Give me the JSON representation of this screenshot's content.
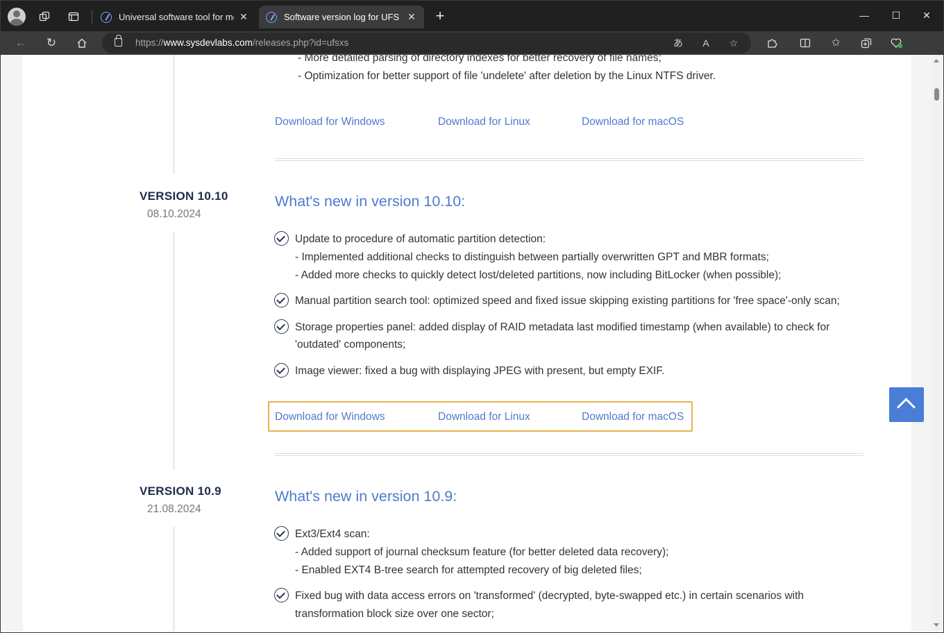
{
  "browser": {
    "tabs": [
      {
        "title": "Universal software tool for most c",
        "active": false
      },
      {
        "title": "Software version log for UFS Explo",
        "active": true
      }
    ],
    "url_prefix": "https://",
    "url_host": "www.sysdevlabs.com",
    "url_path": "/releases.php?id=ufsxs"
  },
  "icons": {
    "avatar": "profile-avatar",
    "workspaces": "workspaces-icon",
    "tab_actions": "tab-actions-icon",
    "back": "back-arrow-icon",
    "refresh": "refresh-icon",
    "home": "home-icon",
    "read_aloud": "read-aloud-icon",
    "translate": "translate-icon",
    "favorite": "star-icon",
    "extensions": "puzzle-icon",
    "split": "split-screen-icon",
    "favorites": "favorites-icon",
    "collections": "collections-icon",
    "health": "browser-essentials-icon"
  },
  "colors": {
    "link": "#4f7acd",
    "heading_dark": "#1f2b4b",
    "highlight": "#e8b04a",
    "to_top": "#4a7dd6"
  },
  "top_section": {
    "lines": [
      "- More detailed parsing of directory indexes for better recovery of file names;",
      "- Optimization for better support of file 'undelete' after deletion by the Linux NTFS driver."
    ],
    "downloads": [
      "Download for Windows",
      "Download for Linux",
      "Download for macOS"
    ]
  },
  "version_10_10": {
    "label": "VERSION 10.10",
    "date": "08.10.2024",
    "heading": "What's new in version 10.10:",
    "items": [
      {
        "text": "Update to procedure of automatic partition detection:",
        "subs": [
          "- Implemented additional checks to distinguish between partially overwritten GPT and MBR formats;",
          "- Added more checks to quickly detect lost/deleted partitions, now including BitLocker (when possible);"
        ]
      },
      {
        "text": "Manual partition search tool: optimized speed and fixed issue skipping existing partitions for 'free space'-only scan;"
      },
      {
        "text": "Storage properties panel: added display of RAID metadata last modified timestamp (when available) to check for",
        "cont": "'outdated' components;"
      },
      {
        "text": "Image viewer: fixed a bug with displaying JPEG with present, but empty EXIF."
      }
    ],
    "downloads": [
      "Download for Windows",
      "Download for Linux",
      "Download for macOS"
    ]
  },
  "version_10_9": {
    "label": "VERSION 10.9",
    "date": "21.08.2024",
    "heading": "What's new in version 10.9:",
    "items": [
      {
        "text": "Ext3/Ext4 scan:",
        "subs": [
          "- Added support of journal checksum feature (for better deleted data recovery);",
          "- Enabled EXT4 B-tree search for attempted recovery of big deleted files;"
        ]
      },
      {
        "text": "Fixed bug with data access errors on 'transformed' (decrypted, byte-swapped etc.) in certain scenarios with",
        "cont": "transformation block size over one sector;"
      }
    ]
  }
}
